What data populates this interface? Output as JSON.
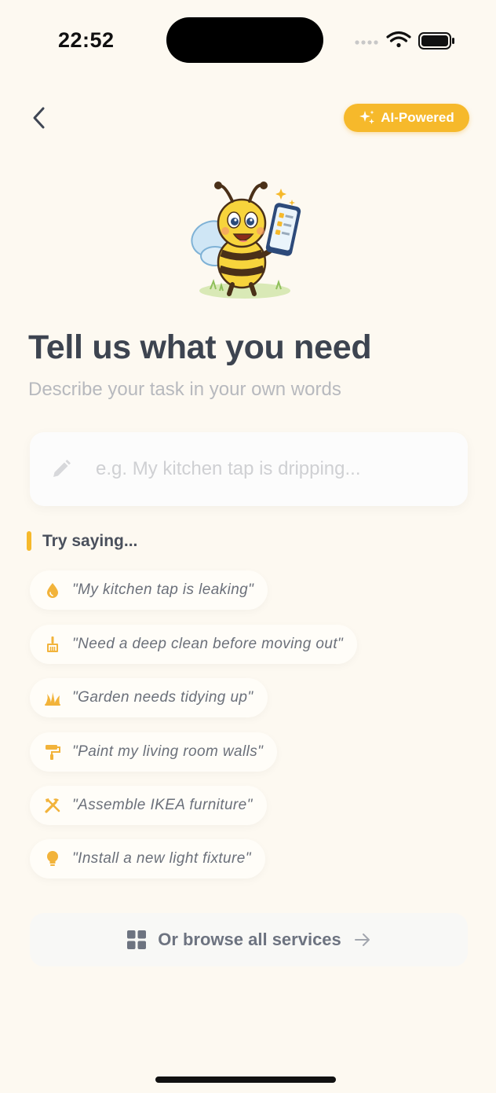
{
  "status_bar": {
    "time": "22:52"
  },
  "header": {
    "back_icon": "chevron-left-icon",
    "badge_label": "AI-Powered",
    "badge_icon": "sparkles-icon",
    "badge_color": "#f6b92b"
  },
  "main": {
    "title": "Tell us what you need",
    "subtitle": "Describe your task in your own words",
    "input": {
      "placeholder": "e.g. My kitchen tap is dripping...",
      "value": "",
      "icon": "pencil-icon"
    },
    "try_saying": {
      "heading": "Try saying...",
      "suggestions": [
        {
          "icon": "water-drop-icon",
          "text": "\"My kitchen tap is leaking\""
        },
        {
          "icon": "broom-icon",
          "text": "\"Need a deep clean before moving out\""
        },
        {
          "icon": "grass-icon",
          "text": "\"Garden needs tidying up\""
        },
        {
          "icon": "paint-roller-icon",
          "text": "\"Paint my living room walls\""
        },
        {
          "icon": "tools-icon",
          "text": "\"Assemble IKEA furniture\""
        },
        {
          "icon": "lightbulb-icon",
          "text": "\"Install a new light fixture\""
        }
      ]
    },
    "browse": {
      "label": "Or browse all services",
      "icon": "grid-icon",
      "arrow_icon": "arrow-right-icon"
    }
  },
  "colors": {
    "background": "#fdf9f1",
    "accent": "#f6b92b",
    "title": "#3d4450"
  }
}
